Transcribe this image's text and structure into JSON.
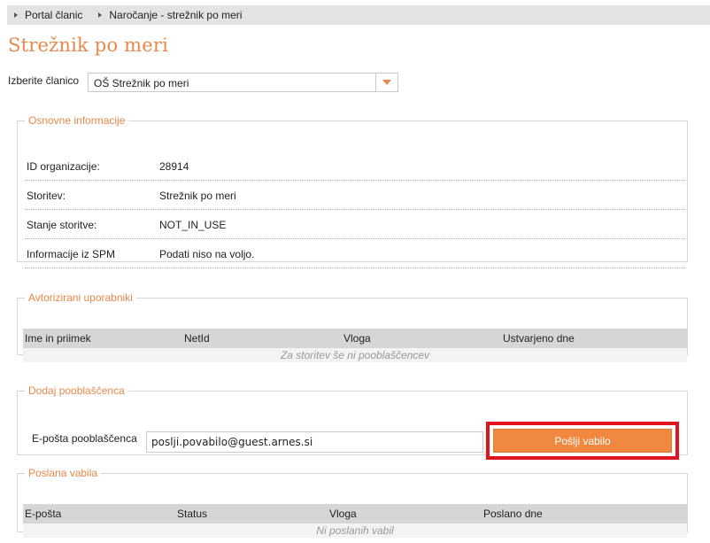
{
  "breadcrumb": {
    "items": [
      {
        "label": "Portal članic"
      },
      {
        "label": "Naročanje - strežnik po meri"
      }
    ]
  },
  "page": {
    "title": "Strežnik po meri"
  },
  "member_select": {
    "label": "Izberite članico",
    "selected": "OŠ Strežnik po meri"
  },
  "basic_info": {
    "legend": "Osnovne informacije",
    "rows": [
      {
        "key": "ID organizacije:",
        "value": "28914"
      },
      {
        "key": "Storitev:",
        "value": "Strežnik po meri"
      },
      {
        "key": "Stanje storitve:",
        "value": "NOT_IN_USE"
      },
      {
        "key": "Informacije iz SPM",
        "value": "Podati niso na voljo."
      }
    ]
  },
  "authorized_users": {
    "legend": "Avtorizirani uporabniki",
    "columns": [
      "Ime in priimek",
      "NetId",
      "Vloga",
      "Ustvarjeno dne"
    ],
    "empty_text": "Za storitev še ni pooblaščencev"
  },
  "add_delegate": {
    "legend": "Dodaj pooblaščenca",
    "email_label": "E-pošta pooblaščenca",
    "email_value": "poslji.povabilo@guest.arnes.si",
    "send_label": "Pošlji vabilo",
    "highlight_color": "#e0141e"
  },
  "sent_invites": {
    "legend": "Poslana vabila",
    "columns": [
      "E-pošta",
      "Status",
      "Vloga",
      "Poslano dne"
    ],
    "empty_text": "Ni poslanih vabil"
  },
  "colors": {
    "accent": "#e8884a",
    "button": "#f0883f"
  }
}
